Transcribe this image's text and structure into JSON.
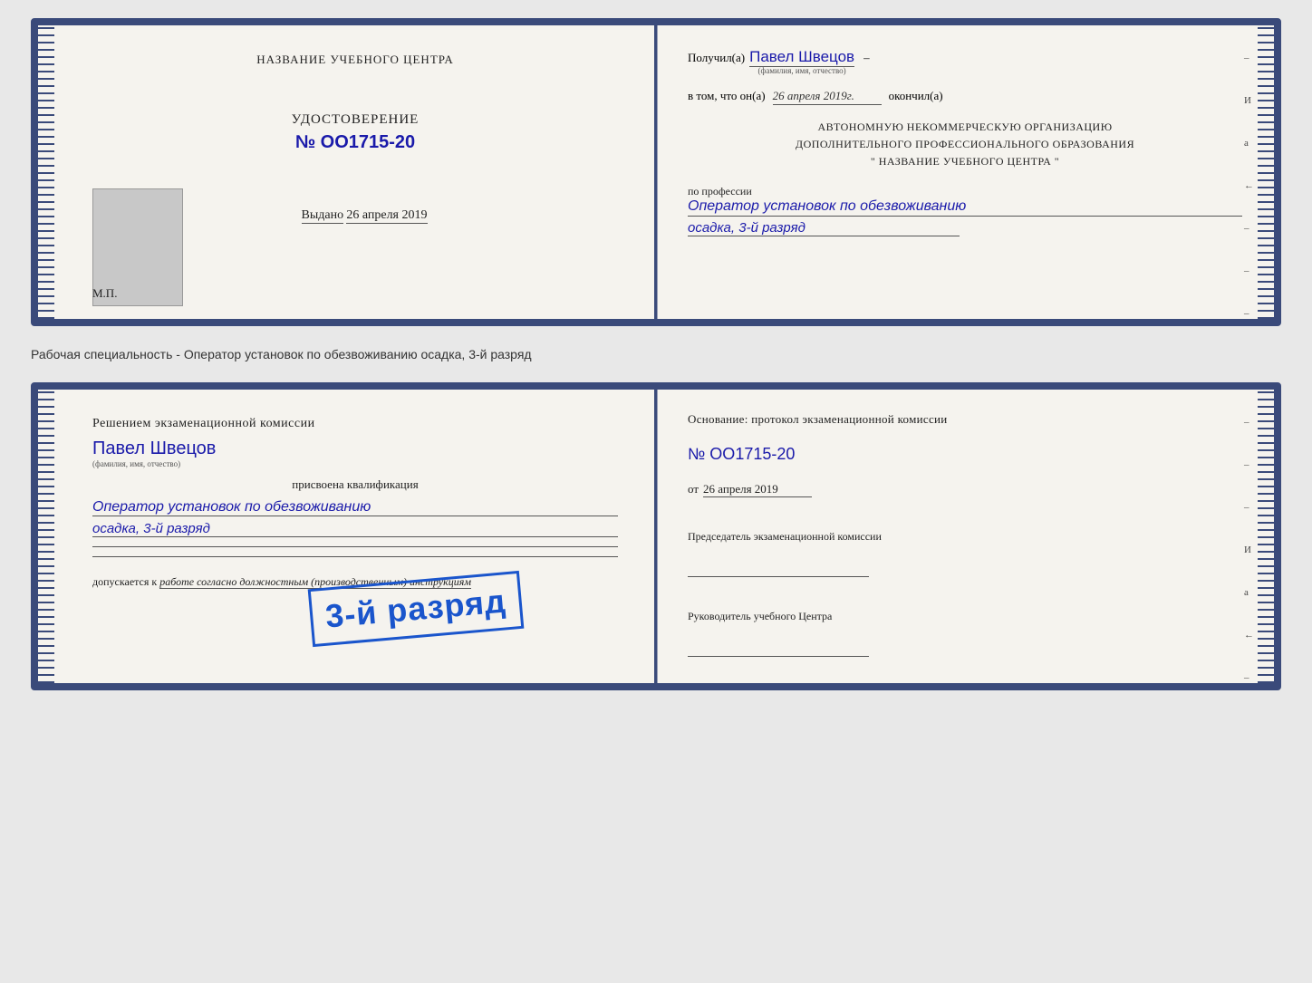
{
  "doc1": {
    "left": {
      "training_center_title": "НАЗВАНИЕ УЧЕБНОГО ЦЕНТРА",
      "cert_type": "УДОСТОВЕРЕНИЕ",
      "cert_number": "№ OO1715-20",
      "issued_label": "Выдано",
      "issued_date": "26 апреля 2019",
      "mp_label": "М.П."
    },
    "right": {
      "received_label": "Получил(а)",
      "recipient_name": "Павел Швецов",
      "name_subtitle": "(фамилия, имя, отчество)",
      "dash1": "–",
      "that_label": "в том, что он(а)",
      "completion_date": "26 апреля 2019г.",
      "completed_label": "окончил(а)",
      "org_line1": "АВТОНОМНУЮ НЕКОММЕРЧЕСКУЮ ОРГАНИЗАЦИЮ",
      "org_line2": "ДОПОЛНИТЕЛЬНОГО ПРОФЕССИОНАЛЬНОГО ОБРАЗОВАНИЯ",
      "org_line3": "\"    НАЗВАНИЕ УЧЕБНОГО ЦЕНТРА    \"",
      "right_label_i": "И",
      "right_label_a": "а",
      "right_label_arrow": "←",
      "profession_label": "по профессии",
      "profession_value": "Оператор установок по обезвоживанию",
      "profession_subvalue": "осадка, 3-й разряд",
      "right_dashes": [
        "-",
        "-",
        "-",
        "-",
        "-"
      ]
    }
  },
  "separator": {
    "text": "Рабочая специальность - Оператор установок по обезвоживанию осадка, 3-й разряд"
  },
  "doc2": {
    "left": {
      "decision_title": "Решением экзаменационной комиссии",
      "person_name": "Павел Швецов",
      "name_subtitle": "(фамилия, имя, отчество)",
      "assigned_text": "присвоена квалификация",
      "qualification_line1": "Оператор установок по обезвоживанию",
      "qualification_line2": "осадка, 3-й разряд",
      "allowed_text": "допускается к",
      "allowed_value": "работе согласно должностным (производственным) инструкциям"
    },
    "right": {
      "basis_label": "Основание: протокол экзаменационной комиссии",
      "proto_number": "№ OO1715-20",
      "from_label": "от",
      "from_date": "26 апреля 2019",
      "chairman_title": "Председатель экзаменационной комиссии",
      "leader_title": "Руководитель учебного Центра",
      "right_label_i": "И",
      "right_label_a": "а",
      "right_label_arrow": "←",
      "right_dashes": [
        "-",
        "-",
        "-",
        "-",
        "-"
      ]
    },
    "stamp": {
      "text": "3-й разряд"
    }
  }
}
